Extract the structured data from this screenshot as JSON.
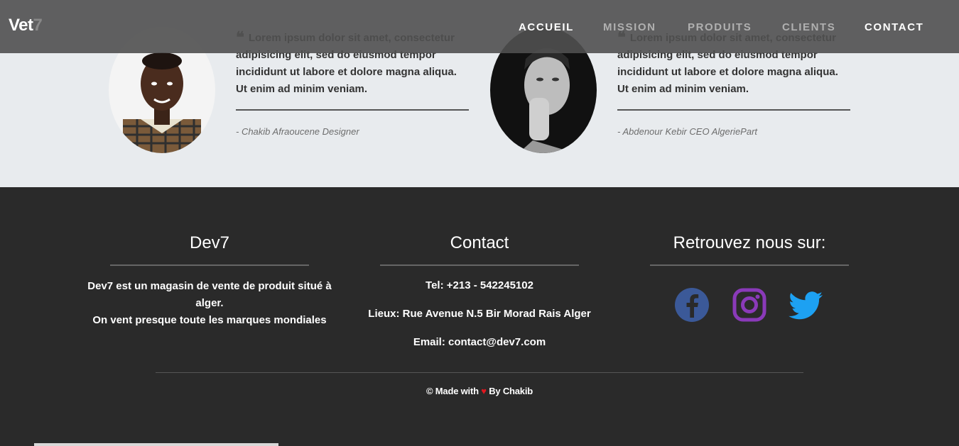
{
  "nav": {
    "brand_main": "Vet",
    "brand_accent": "7",
    "items": [
      {
        "label": "Accueil"
      },
      {
        "label": "Mission"
      },
      {
        "label": "Produits"
      },
      {
        "label": "Clients"
      },
      {
        "label": "Contact"
      }
    ]
  },
  "testimonials": [
    {
      "quote": "Lorem ipsum dolor sit amet, consectetur adipisicing elit, sed do eiusmod tempor incididunt ut labore et dolore magna aliqua. Ut enim ad minim veniam.",
      "author": "- Chakib Afraoucene Designer"
    },
    {
      "quote": "Lorem ipsum dolor sit amet, consectetur adipisicing elit, sed do eiusmod tempor incididunt ut labore et dolore magna aliqua. Ut enim ad minim veniam.",
      "author": "- Abdenour Kebir CEO AlgeriePart"
    }
  ],
  "footer": {
    "about": {
      "title": "Dev7",
      "line1": "Dev7 est un magasin de vente de produit situé à alger.",
      "line2": "On vent presque toute les marques mondiales"
    },
    "contact": {
      "title": "Contact",
      "tel": "Tel: +213 - 542245102",
      "address": "Lieux: Rue Avenue N.5 Bir Morad Rais Alger",
      "email": "Email: contact@dev7.com"
    },
    "social": {
      "title": "Retrouvez nous sur:",
      "icons": [
        "facebook-icon",
        "instagram-icon",
        "twitter-icon"
      ]
    },
    "credits": {
      "prefix": "© Made with",
      "heart": "♥",
      "suffix": "By Chakib"
    }
  },
  "colors": {
    "facebook": "#3b5998",
    "instagram": "#8a3ab9",
    "twitter": "#1da1f2",
    "heart": "#e0171f"
  }
}
